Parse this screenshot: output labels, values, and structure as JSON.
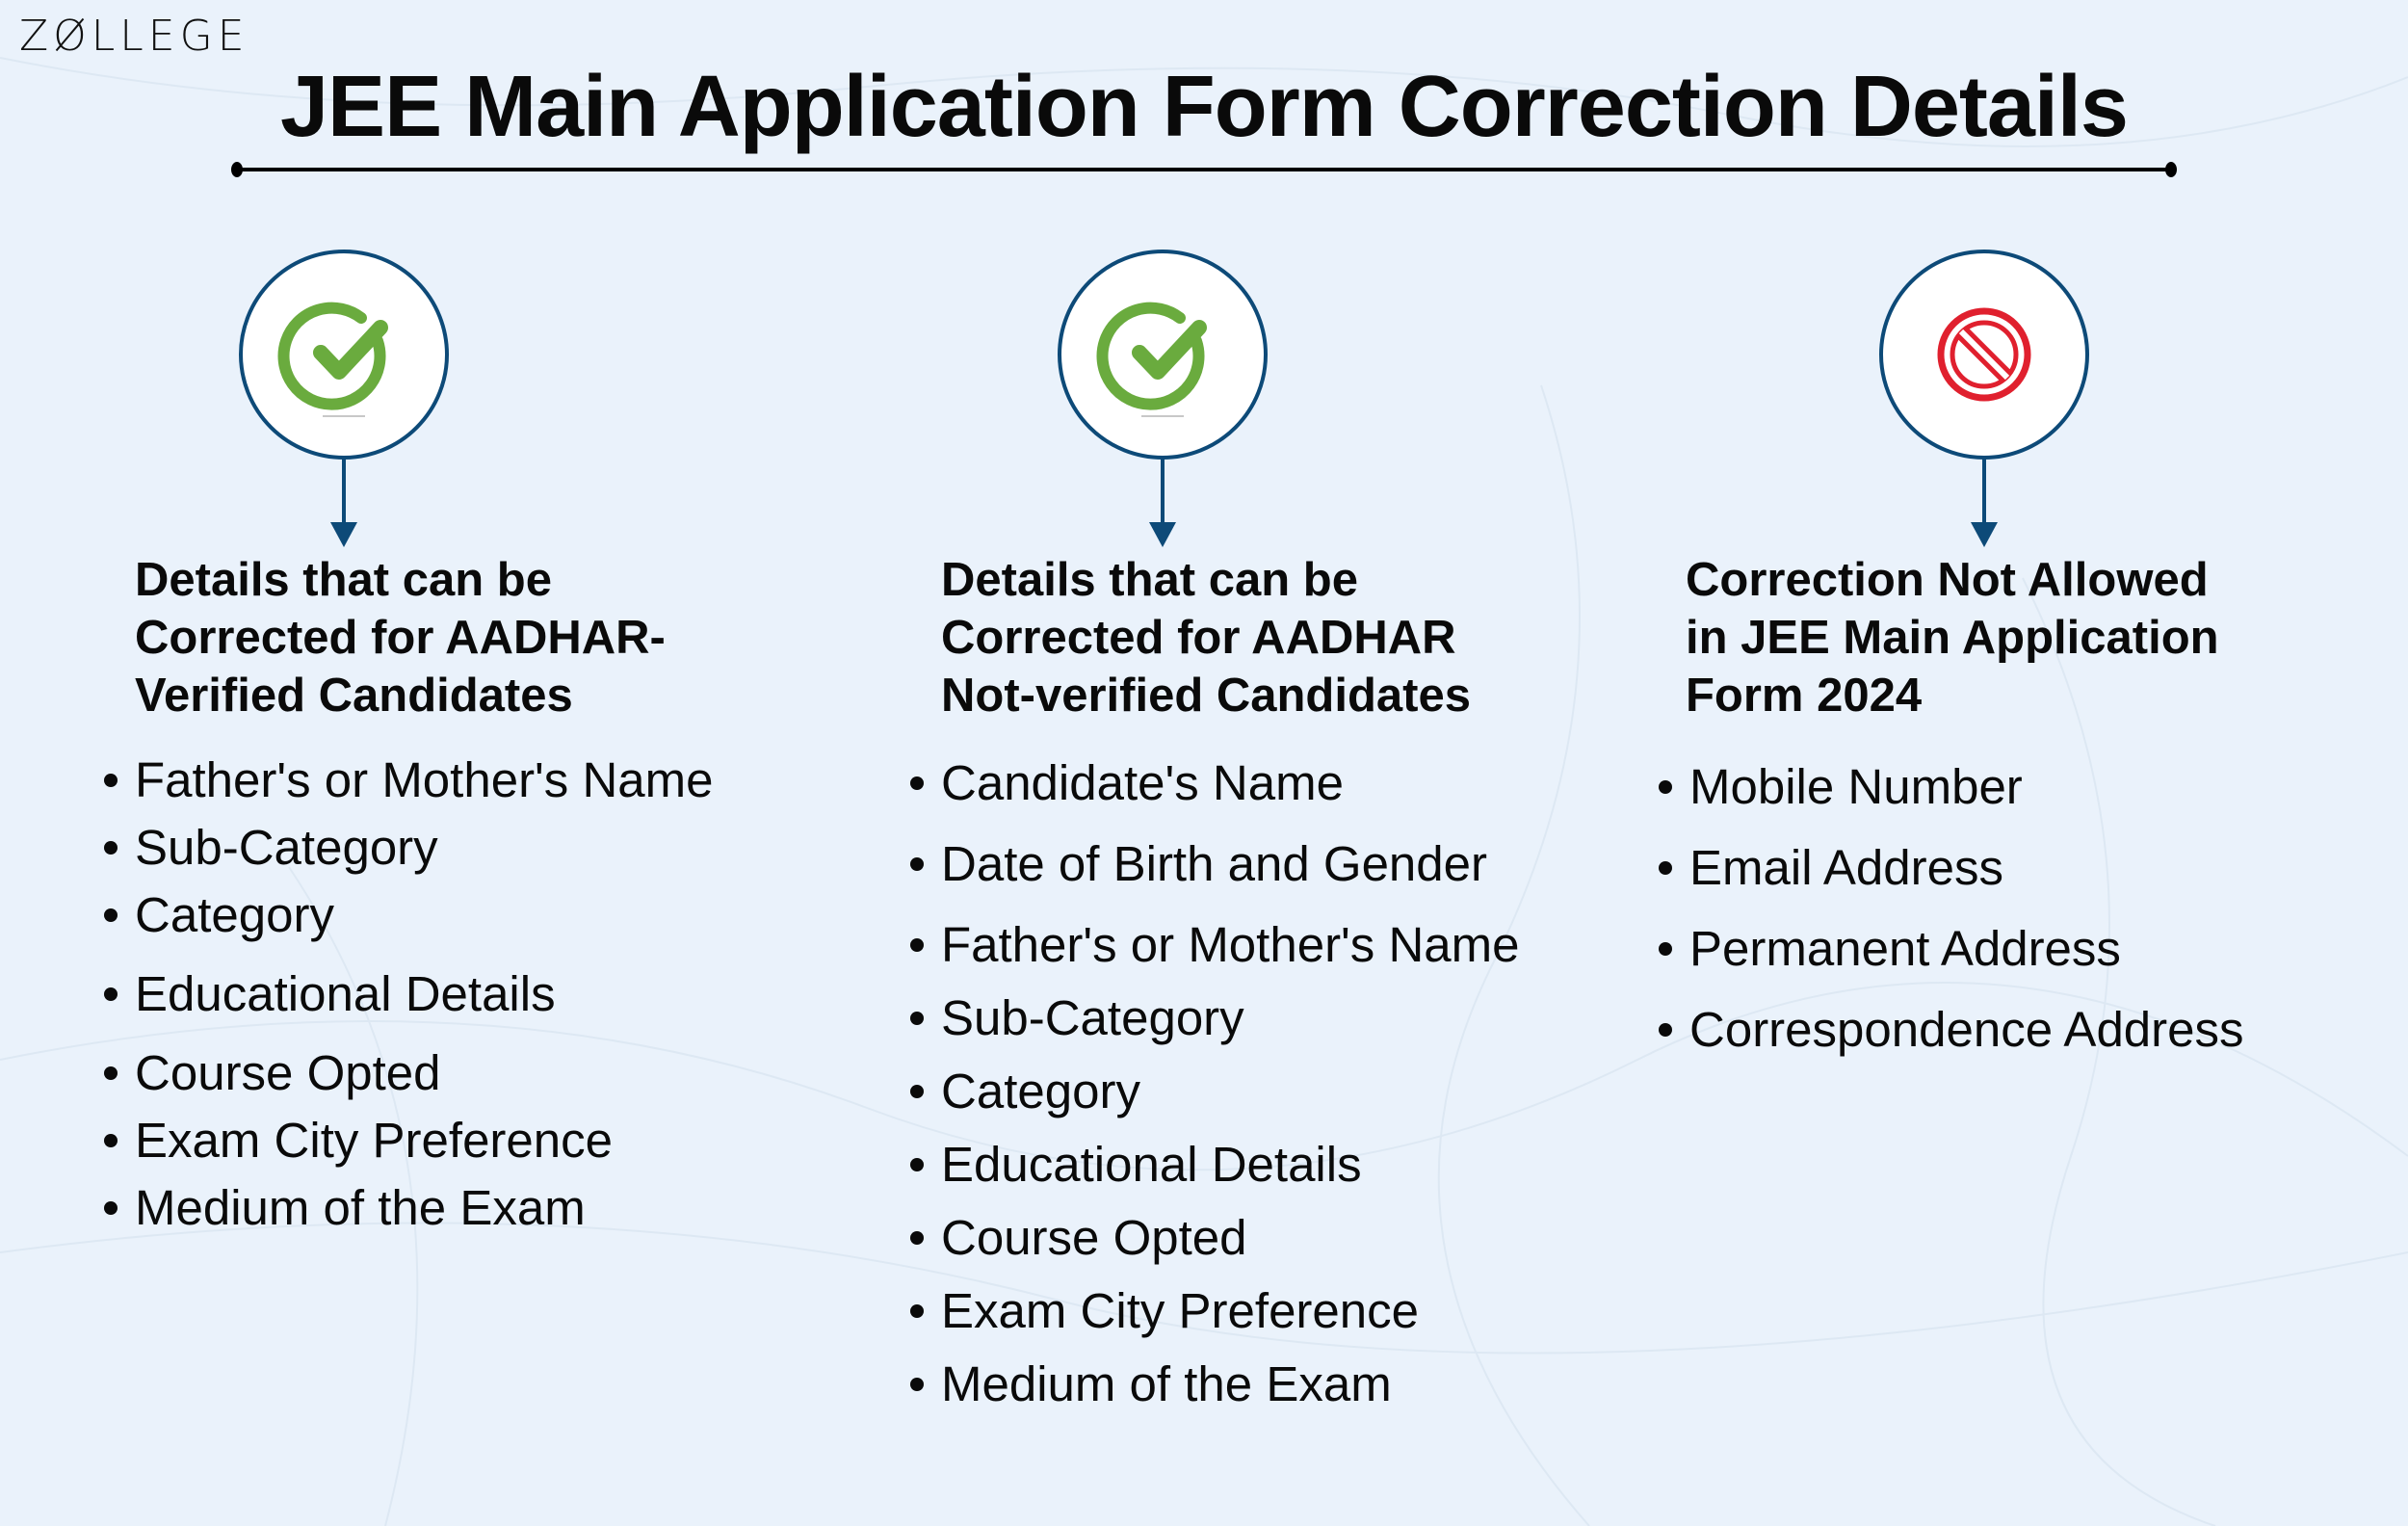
{
  "brand": {
    "logo_text": "ZØLLEGE"
  },
  "title": "JEE Main Application Form Correction Details",
  "colors": {
    "background": "#eaf2fb",
    "ring": "#0d4a78",
    "arrow": "#0d4a78",
    "check_green": "#6aab3e",
    "prohibit_red": "#e0202e",
    "text": "#0a0a0a"
  },
  "columns": [
    {
      "icon": "check-circle-icon",
      "heading_lines": [
        "Details that can be",
        "Corrected for AADHAR-",
        "Verified Candidates"
      ],
      "items": [
        "Father's or Mother's Name",
        "Sub-Category",
        "Category",
        "Educational Details",
        "Course Opted",
        "Exam City Preference",
        "Medium of the Exam"
      ]
    },
    {
      "icon": "check-circle-icon",
      "heading_lines": [
        "Details that can be",
        "Corrected for AADHAR",
        "Not-verified Candidates"
      ],
      "items": [
        "Candidate's Name",
        "Date of Birth and Gender",
        "Father's or Mother's Name",
        "Sub-Category",
        "Category",
        "Educational Details",
        "Course Opted",
        "Exam City Preference",
        "Medium of the Exam"
      ]
    },
    {
      "icon": "prohibited-icon",
      "heading_lines": [
        "Correction Not Allowed",
        "in JEE Main Application",
        "Form 2024"
      ],
      "items": [
        "Mobile Number",
        "Email Address",
        "Permanent Address",
        "Correspondence Address"
      ]
    }
  ]
}
